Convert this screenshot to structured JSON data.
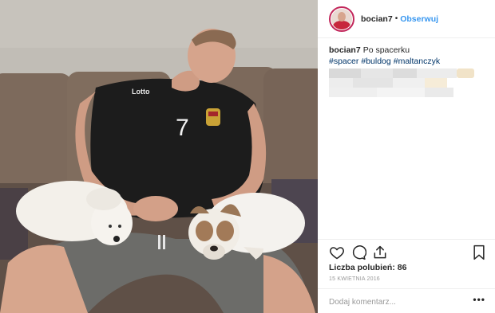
{
  "post": {
    "username": "bocian7",
    "separator": "•",
    "follow_label": "Obserwuj",
    "caption_user": "bocian7",
    "caption_text": "Po spacerku",
    "hashtags": [
      "#spacer",
      "#buldog",
      "#maltanczyk"
    ],
    "likes_label": "Liczba polubień: 86",
    "date": "15 KWIETNIA 2016",
    "comment_placeholder": "Dodaj komentarz...",
    "more_label": "•••"
  },
  "photo": {
    "jersey_brand": "Lotto",
    "jersey_number": "7"
  },
  "icons": {
    "like": "heart-icon",
    "comment": "comment-icon",
    "share": "share-icon",
    "save": "bookmark-icon"
  },
  "colors": {
    "link": "#3897f0",
    "hashtag": "#003569",
    "avatar_ring": "#c2275b"
  }
}
